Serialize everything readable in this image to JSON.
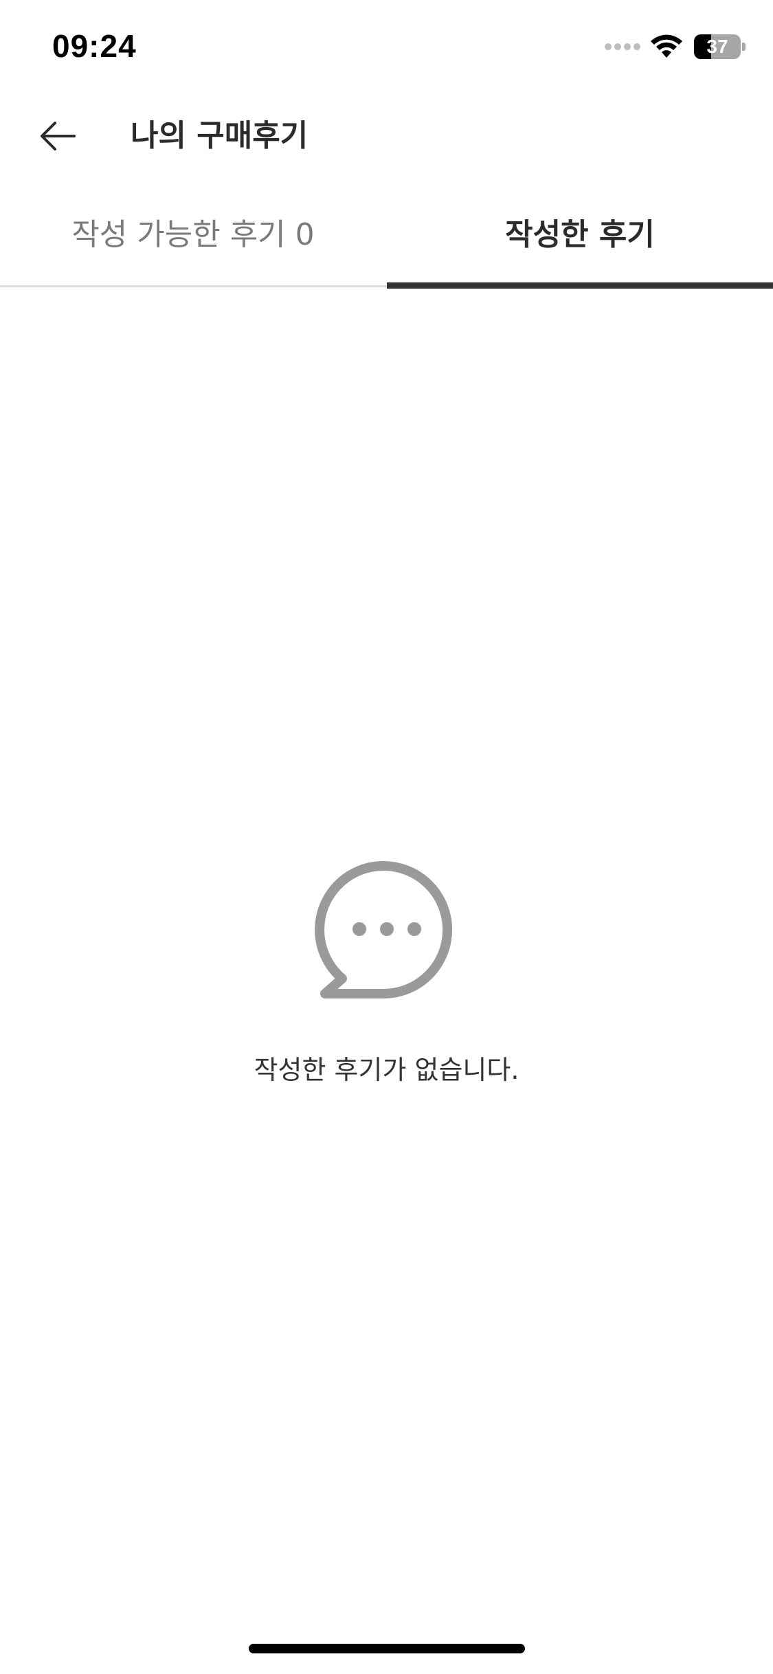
{
  "status_bar": {
    "time": "09:24",
    "battery_level": "37",
    "battery_fraction": 0.37,
    "icons": [
      "cellular-signal-icon",
      "wifi-icon",
      "battery-icon"
    ]
  },
  "header": {
    "back_icon": "arrow-left-icon",
    "title": "나의 구매후기"
  },
  "tabs": [
    {
      "label": "작성 가능한 후기 0",
      "selected": false
    },
    {
      "label": "작성한 후기",
      "selected": true
    }
  ],
  "empty_state": {
    "icon": "speech-bubble-ellipsis-icon",
    "message": "작성한 후기가 없습니다."
  },
  "colors": {
    "tab_indicator": "#333333",
    "inactive_tab_text": "#7a7a7a",
    "empty_icon": "#9a9a9a",
    "divider": "#dcdcdc"
  }
}
